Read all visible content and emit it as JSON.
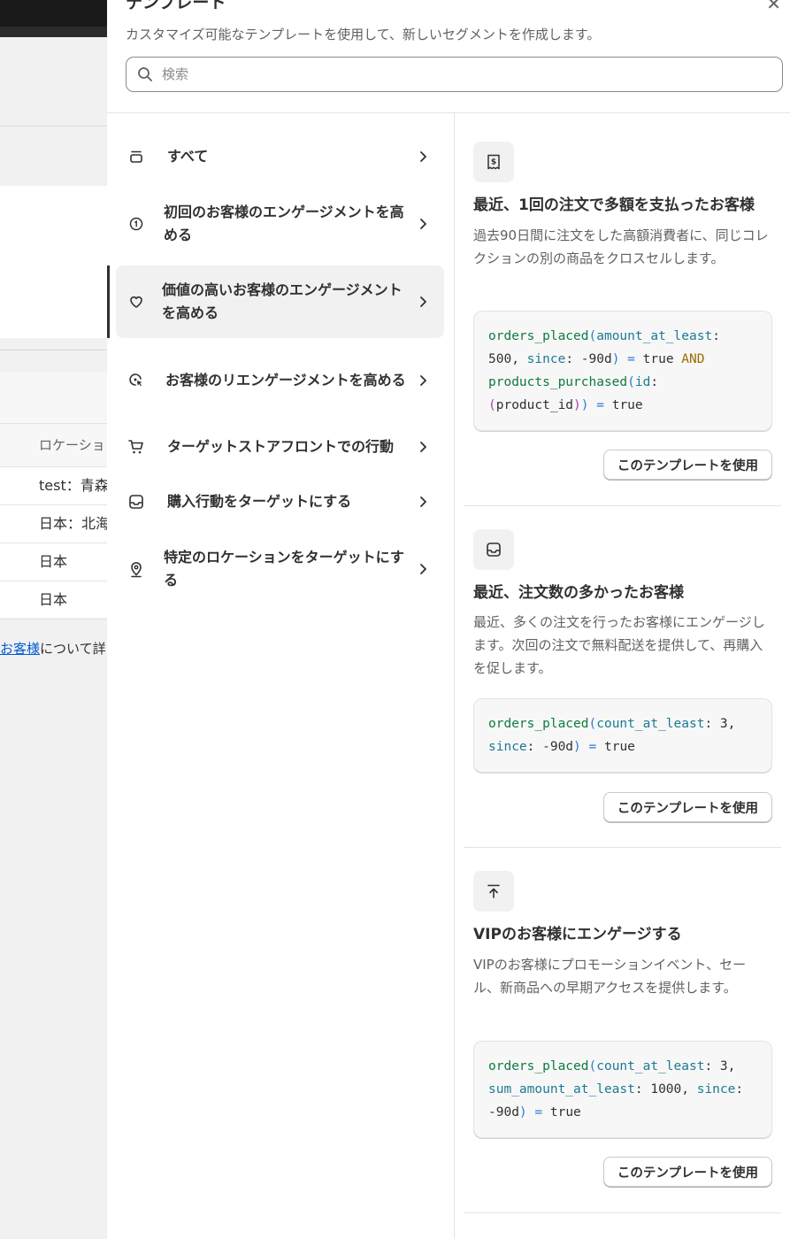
{
  "background": {
    "table_header": "ロケーショ",
    "rows": [
      "test：青森",
      "日本：北海",
      "日本",
      "日本"
    ],
    "footnote_link": "お客様",
    "footnote_text": "について詳し"
  },
  "drawer": {
    "title": "テンプレート",
    "subtitle": "カスタマイズ可能なテンプレートを使用して、新しいセグメントを作成します。",
    "search_placeholder": "検索",
    "categories": [
      {
        "label": "すべて",
        "icon": "stack-icon"
      },
      {
        "label": "初回のお客様のエンゲージメントを高める",
        "icon": "one-circle-icon"
      },
      {
        "label": "価値の高いお客様のエンゲージメントを高める",
        "icon": "heart-icon"
      },
      {
        "label": "お客様のリエンゲージメントを高める",
        "icon": "cursor-refresh-icon"
      },
      {
        "label": "ターゲットストアフロントでの行動",
        "icon": "cart-icon"
      },
      {
        "label": "購入行動をターゲットにする",
        "icon": "inbox-icon"
      },
      {
        "label": "特定のロケーションをターゲットにする",
        "icon": "location-pin-icon"
      }
    ],
    "active_category_index": 2,
    "use_button_label": "このテンプレートを使用",
    "templates": [
      {
        "icon": "receipt-dollar-icon",
        "title": "最近、1回の注文で多額を支払ったお客様",
        "description": "過去90日間に注文をした高額消費者に、同じコレクションの別の商品をクロスセルします。",
        "code": "orders_placed(amount_at_least: 500, since: -90d) = true AND products_purchased(id: (product_id)) = true"
      },
      {
        "icon": "inbox-icon",
        "title": "最近、注文数の多かったお客様",
        "description": "最近、多くの注文を行ったお客様にエンゲージします。次回の注文で無料配送を提供して、再購入を促します。",
        "code": "orders_placed(count_at_least: 3, since: -90d) = true"
      },
      {
        "icon": "arrow-up-bar-icon",
        "title": "VIPのお客様にエンゲージする",
        "description": "VIPのお客様にプロモーションイベント、セール、新商品への早期アクセスを提供します。",
        "code": "orders_placed(count_at_least: 3, sum_amount_at_least: 1000, since: -90d) = true"
      }
    ]
  }
}
